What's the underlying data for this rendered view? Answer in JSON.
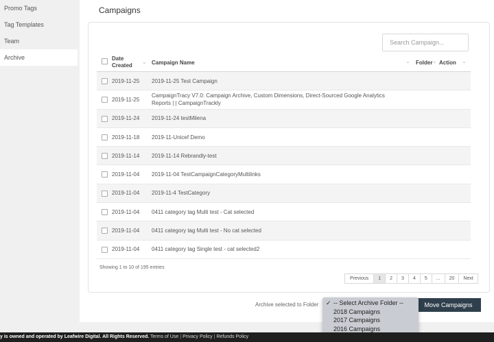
{
  "sidebar": {
    "items": [
      {
        "label": "Promo Tags"
      },
      {
        "label": "Tag Templates"
      },
      {
        "label": "Team"
      },
      {
        "label": "Archive"
      }
    ]
  },
  "main": {
    "title": "Campaigns",
    "search_placeholder": "Search Campaign...",
    "columns": {
      "date": "Date Created",
      "name": "Campaign Name",
      "folder": "Folder",
      "action": "Action"
    },
    "rows": [
      {
        "date": "2019-11-25",
        "name": "2019-11-25 Test Campaign"
      },
      {
        "date": "2019-11-25",
        "name": "CampaignTracy V7.0: Campaign Archive, Custom Dimensions, Direct-Sourced Google Analytics Reports | | CampaignTrackly"
      },
      {
        "date": "2019-11-24",
        "name": "2019-11-24 testMilena"
      },
      {
        "date": "2019-11-18",
        "name": "2019-11-Unicef Demo"
      },
      {
        "date": "2019-11-14",
        "name": "2019-11-14 Rebrandly-test"
      },
      {
        "date": "2019-11-04",
        "name": "2019-11-04 TestCampaignCategoryMultilinks"
      },
      {
        "date": "2019-11-04",
        "name": "2019-11-4 TestCategory"
      },
      {
        "date": "2019-11-04",
        "name": "0411 category tag Multi test - Cat selected"
      },
      {
        "date": "2019-11-04",
        "name": "0411 category tag Multi test - No cat selected"
      },
      {
        "date": "2019-11-04",
        "name": "0411 category tag Single test - cat selected2"
      }
    ],
    "info": "Showing 1 to 10 of 195 entries",
    "pagination": {
      "previous": "Previous",
      "pages": [
        "1",
        "2",
        "3",
        "4",
        "5",
        "...",
        "20"
      ],
      "current": "1",
      "next": "Next"
    }
  },
  "archive": {
    "label": "Archive selected to Folder",
    "move_button": "Move Campaigns",
    "dropdown_options": [
      "-- Select Archive Folder --",
      "2018 Campaigns",
      "2017 Campaigns",
      "2016 Campaigns"
    ],
    "selected_index": 0
  },
  "footer": {
    "text": "y is owned and operated by Leafwire Digital. All Rights Reserved.",
    "links": [
      "Terms of Use",
      "Privacy Policy",
      "Refunds Policy"
    ]
  },
  "colors": {
    "button_dark": "#2f3f4c",
    "footer_bg": "#1f1f1f",
    "row_stripe": "#f4f4f4"
  }
}
